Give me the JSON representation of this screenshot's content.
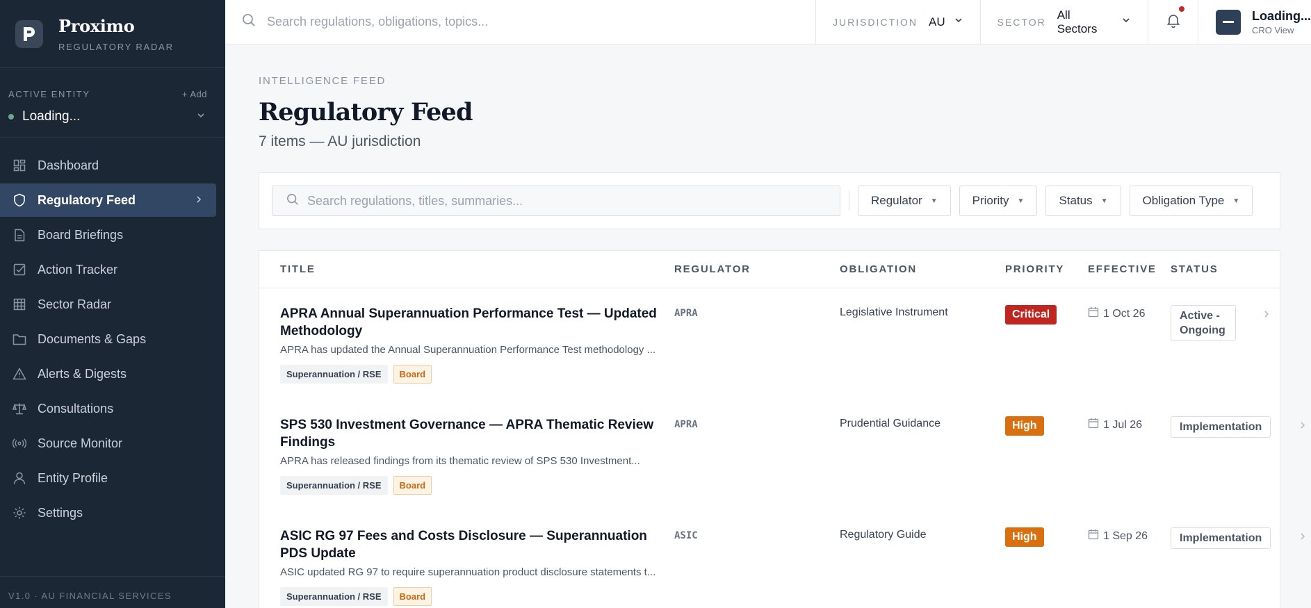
{
  "sidebar": {
    "brand_name": "Proximo",
    "brand_sub": "REGULATORY RADAR",
    "entity_label": "ACTIVE ENTITY",
    "entity_add": "+ Add",
    "entity_value": "Loading...",
    "nav": [
      {
        "label": "Dashboard",
        "icon": "dashboard-icon"
      },
      {
        "label": "Regulatory Feed",
        "icon": "shield-icon",
        "active": true
      },
      {
        "label": "Board Briefings",
        "icon": "document-icon"
      },
      {
        "label": "Action Tracker",
        "icon": "checkbox-icon"
      },
      {
        "label": "Sector Radar",
        "icon": "grid-icon"
      },
      {
        "label": "Documents & Gaps",
        "icon": "folder-icon"
      },
      {
        "label": "Alerts & Digests",
        "icon": "warning-icon"
      },
      {
        "label": "Consultations",
        "icon": "scales-icon"
      },
      {
        "label": "Source Monitor",
        "icon": "broadcast-icon"
      },
      {
        "label": "Entity Profile",
        "icon": "user-icon"
      },
      {
        "label": "Settings",
        "icon": "gear-icon"
      }
    ],
    "footer": "V1.0 · AU FINANCIAL SERVICES"
  },
  "topbar": {
    "search_placeholder": "Search regulations, obligations, topics...",
    "jurisdiction_label": "JURISDICTION",
    "jurisdiction_value": "AU",
    "sector_label": "SECTOR",
    "sector_value": "All Sectors",
    "user_name": "Loading...",
    "user_role": "CRO View"
  },
  "main": {
    "eyebrow": "INTELLIGENCE FEED",
    "title": "Regulatory Feed",
    "subtitle": "7 items — AU jurisdiction",
    "filter_search_placeholder": "Search regulations, titles, summaries...",
    "filters": [
      "Regulator",
      "Priority",
      "Status",
      "Obligation Type"
    ],
    "columns": [
      "TITLE",
      "REGULATOR",
      "OBLIGATION",
      "PRIORITY",
      "EFFECTIVE",
      "STATUS"
    ],
    "rows": [
      {
        "title": "APRA Annual Superannuation Performance Test — Updated Methodology",
        "summary": "APRA has updated the Annual Superannuation Performance Test methodology ...",
        "sector_tag": "Superannuation / RSE",
        "board_tag": "Board",
        "regulator": "APRA",
        "obligation": "Legislative Instrument",
        "priority": "Critical",
        "effective": "1 Oct 26",
        "status": "Active - Ongoing"
      },
      {
        "title": "SPS 530 Investment Governance — APRA Thematic Review Findings",
        "summary": "APRA has released findings from its thematic review of SPS 530 Investment...",
        "sector_tag": "Superannuation / RSE",
        "board_tag": "Board",
        "regulator": "APRA",
        "obligation": "Prudential Guidance",
        "priority": "High",
        "effective": "1 Jul 26",
        "status": "Implementation"
      },
      {
        "title": "ASIC RG 97 Fees and Costs Disclosure — Superannuation PDS Update",
        "summary": "ASIC updated RG 97 to require superannuation product disclosure statements t...",
        "sector_tag": "Superannuation / RSE",
        "board_tag": "Board",
        "regulator": "ASIC",
        "obligation": "Regulatory Guide",
        "priority": "High",
        "effective": "1 Sep 26",
        "status": "Implementation"
      }
    ]
  },
  "colors": {
    "sidebar_bg": "#1c2735",
    "active_nav_bg": "#314763",
    "critical": "#c0261f",
    "high": "#d96f0f",
    "notification_dot": "#c62828"
  }
}
